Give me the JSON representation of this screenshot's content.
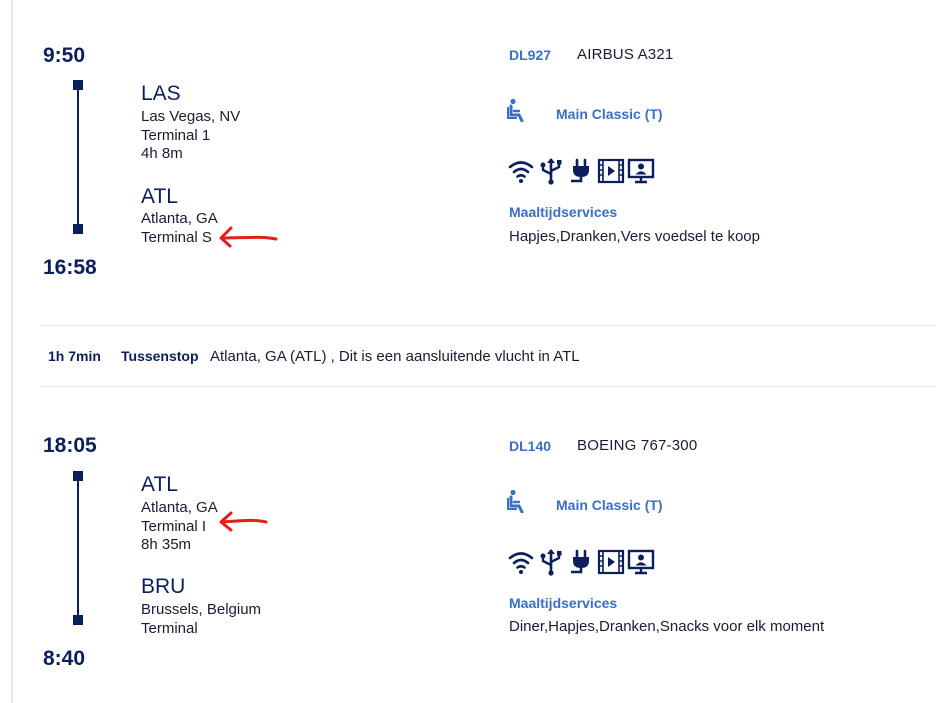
{
  "segments": [
    {
      "departure_time": "9:50",
      "arrival_time": "16:58",
      "origin": {
        "code": "LAS",
        "city": "Las Vegas, NV",
        "terminal": "Terminal 1"
      },
      "duration": "4h 8m",
      "destination": {
        "code": "ATL",
        "city": "Atlanta, GA",
        "terminal": "Terminal S"
      },
      "flight_number": "DL927",
      "aircraft": "AIRBUS A321",
      "cabin": "Main Classic (T)",
      "amenities": [
        "wifi-icon",
        "usb-icon",
        "power-plug-icon",
        "video-icon",
        "personal-screen-icon"
      ],
      "meal_title": "Maaltijdservices",
      "meal_text": "Hapjes,Dranken,Vers voedsel te koop"
    },
    {
      "departure_time": "18:05",
      "arrival_time": "8:40",
      "origin": {
        "code": "ATL",
        "city": "Atlanta, GA",
        "terminal": "Terminal I"
      },
      "duration": "8h 35m",
      "destination": {
        "code": "BRU",
        "city": "Brussels, Belgium",
        "terminal": "Terminal"
      },
      "flight_number": "DL140",
      "aircraft": "BOEING 767-300",
      "cabin": "Main Classic (T)",
      "amenities": [
        "wifi-icon",
        "usb-icon",
        "power-plug-icon",
        "video-icon",
        "personal-screen-icon"
      ],
      "meal_title": "Maaltijdservices",
      "meal_text": "Diner,Hapjes,Dranken,Snacks voor elk moment"
    }
  ],
  "layover": {
    "duration": "1h 7min",
    "label": "Tussenstop",
    "text": "Atlanta, GA (ATL) , Dit is een aansluitende vlucht in ATL"
  },
  "colors": {
    "navy": "#0b1f5c",
    "link_blue": "#3a6fc4",
    "annotation_red": "#e0201b"
  }
}
